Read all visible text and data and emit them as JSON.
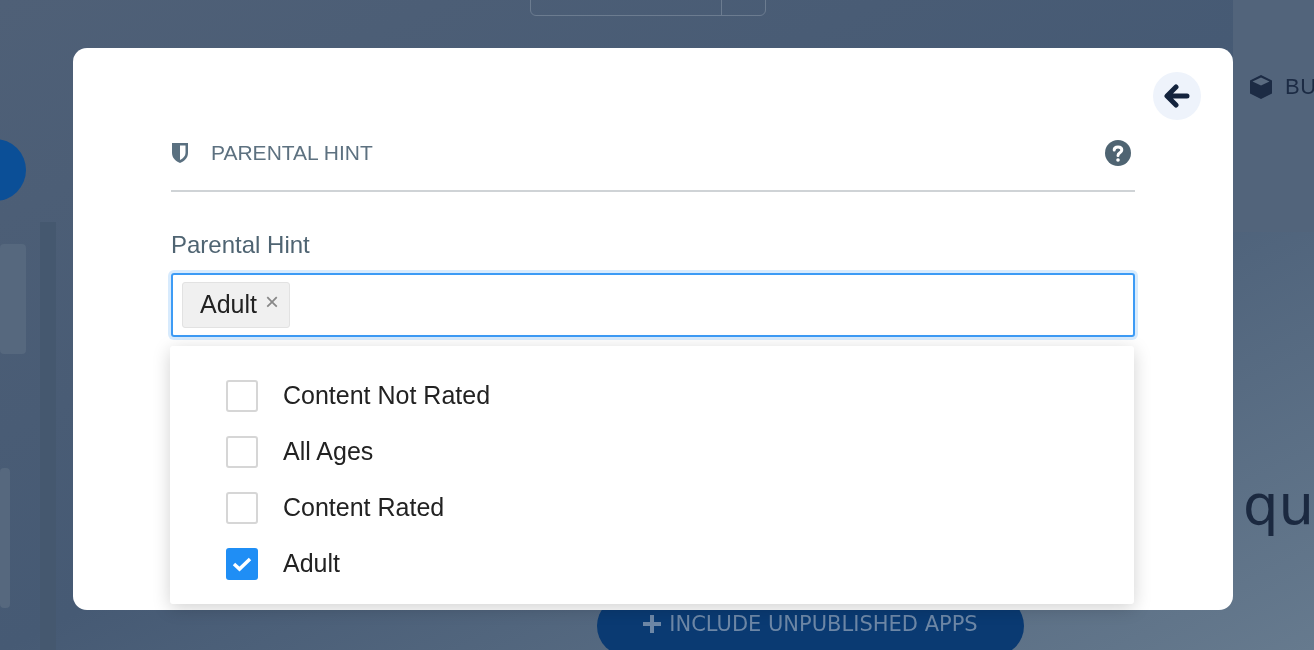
{
  "background": {
    "header_label": "BU",
    "heading_fragment": "qu",
    "include_button": "INCLUDE UNPUBLISHED APPS"
  },
  "modal": {
    "section_title": "PARENTAL HINT",
    "field": {
      "label": "Parental Hint",
      "focused": true,
      "chips": [
        {
          "label": "Adult",
          "remove": "×"
        }
      ]
    },
    "options": [
      {
        "label": "Content Not Rated",
        "checked": false
      },
      {
        "label": "All Ages",
        "checked": false
      },
      {
        "label": "Content Rated",
        "checked": false
      },
      {
        "label": "Adult",
        "checked": true
      }
    ]
  }
}
